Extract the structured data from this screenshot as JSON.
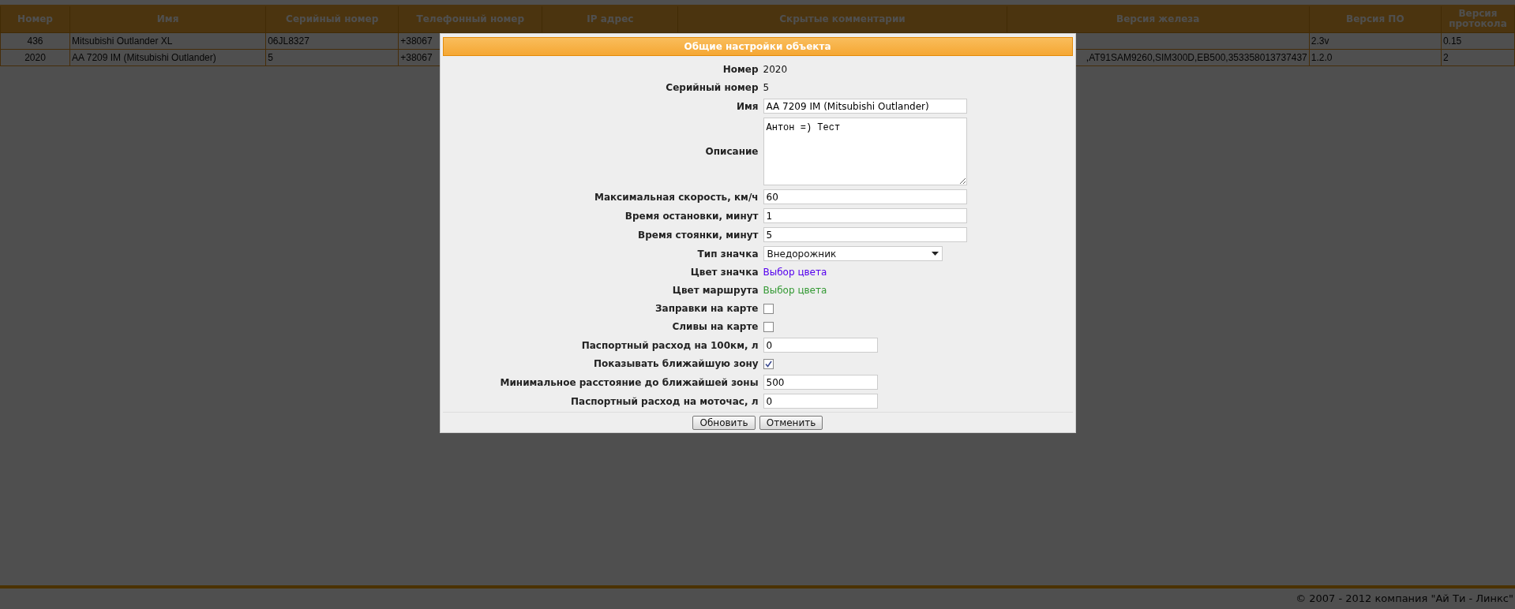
{
  "table": {
    "columns": [
      "Номер",
      "Имя",
      "Серийный номер",
      "Телефонный номер",
      "IP адрес",
      "Скрытые комментарии",
      "Версия железа",
      "Версия ПО",
      "Версия протокола"
    ],
    "rows": [
      [
        "436",
        "Mitsubishi Outlander XL",
        "06JL8327",
        "+38067",
        null,
        null,
        null,
        "2.3v",
        "0.15"
      ],
      [
        "2020",
        "AA 7209 IM (Mitsubishi Outlander)",
        "5",
        "+38067",
        null,
        null,
        ",AT91SAM9260,SIM300D,EB500,353358013737437",
        "1.2.0",
        "2"
      ]
    ]
  },
  "dialog": {
    "title": "Общие настройки объекта",
    "fields": [
      {
        "kind": "static",
        "label": "Номер",
        "value": "2020"
      },
      {
        "kind": "static",
        "label": "Серийный номер",
        "value": "5"
      },
      {
        "kind": "text",
        "label": "Имя",
        "value": "AA 7209 IM (Mitsubishi Outlander)"
      },
      {
        "kind": "textarea",
        "label": "Описание",
        "value": "Антон =) Тест"
      },
      {
        "kind": "text",
        "label": "Максимальная скорость, км/ч",
        "value": "60"
      },
      {
        "kind": "text",
        "label": "Время остановки, минут",
        "value": "1"
      },
      {
        "kind": "text",
        "label": "Время стоянки, минут",
        "value": "5"
      },
      {
        "kind": "select",
        "label": "Тип значка",
        "value": "Внедорожник"
      },
      {
        "kind": "color",
        "label": "Цвет значка",
        "value": "Выбор цвета",
        "color": "#5500ee"
      },
      {
        "kind": "color",
        "label": "Цвет маршрута",
        "value": "Выбор цвета",
        "color": "#339933"
      },
      {
        "kind": "checkbox",
        "label": "Заправки на карте",
        "checked": false
      },
      {
        "kind": "checkbox",
        "label": "Сливы на карте",
        "checked": false
      },
      {
        "kind": "short",
        "label": "Паспортный расход на 100км, л",
        "value": "0"
      },
      {
        "kind": "checkbox",
        "label": "Показывать ближайшую зону",
        "checked": true
      },
      {
        "kind": "short",
        "label": "Минимальное расстояние до ближайшей зоны",
        "value": "500"
      },
      {
        "kind": "short",
        "label": "Паспортный расход на моточас, л",
        "value": "0"
      }
    ],
    "buttons": [
      "Обновить",
      "Отменить"
    ]
  },
  "footer": "© 2007 - 2012 компания \"Ай Ти - Линкс\""
}
